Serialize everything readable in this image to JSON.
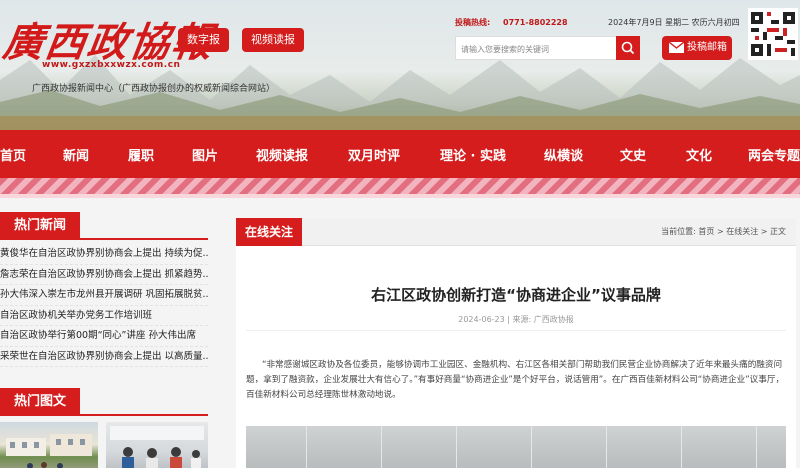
{
  "header": {
    "logo_text": "廣西政協報",
    "logo_url": "www.gxzxbxxwzx.com.cn",
    "tagline": "广西政协报新闻中心（广西政协报创办的权威新闻综合网站）",
    "buttons": [
      "数字报",
      "视频读报"
    ],
    "hotline_label": "投稿热线:",
    "hotline_number": "0771-8802228",
    "date": "2024年7月9日 星期二 农历六月初四",
    "search_placeholder": "请输入您要搜索的关键词",
    "submit_label": "投稿邮箱"
  },
  "nav": {
    "items": [
      "首页",
      "新闻",
      "履职",
      "图片",
      "视频读报",
      "双月时评",
      "理论 · 实践",
      "纵横谈",
      "文史",
      "文化",
      "两会专题"
    ]
  },
  "sidebar": {
    "hot_news_title": "热门新闻",
    "hot_news": [
      "黄俊华在自治区政协界别协商会上提出 持续为促...",
      "詹志荣在自治区政协界别协商会上提出 抓紧趋势...",
      "孙大伟深入崇左市龙州县开展调研 巩固拓展脱贫...",
      "自治区政协机关举办党务工作培训班",
      "自治区政协举行第00期“同心”讲座 孙大伟出席",
      "采荣世在自治区政协界别协商会上提出 以高质量..."
    ],
    "hot_pics_title": "热门图文"
  },
  "main": {
    "section_tab": "在线关注",
    "breadcrumb": "当前位置: 首页 > 在线关注 > 正文",
    "title": "右江区政协创新打造“协商进企业”议事品牌",
    "meta": "2024-06-23 | 来源: 广西政协报",
    "body": "“非常感谢城区政协及各位委员，能够协调市工业园区、金融机构、右江区各相关部门帮助我们民营企业协商解决了近年来最头痛的融资问题，拿到了融资款，企业发展壮大有信心了。”有事好商量“协商进企业”是个好平台，说话管用”。在广西百佳新材料公司“协商进企业”议事厅，百佳新材料公司总经理陈世林激动地说。"
  },
  "colors": {
    "brand_red": "#d51d1d"
  }
}
